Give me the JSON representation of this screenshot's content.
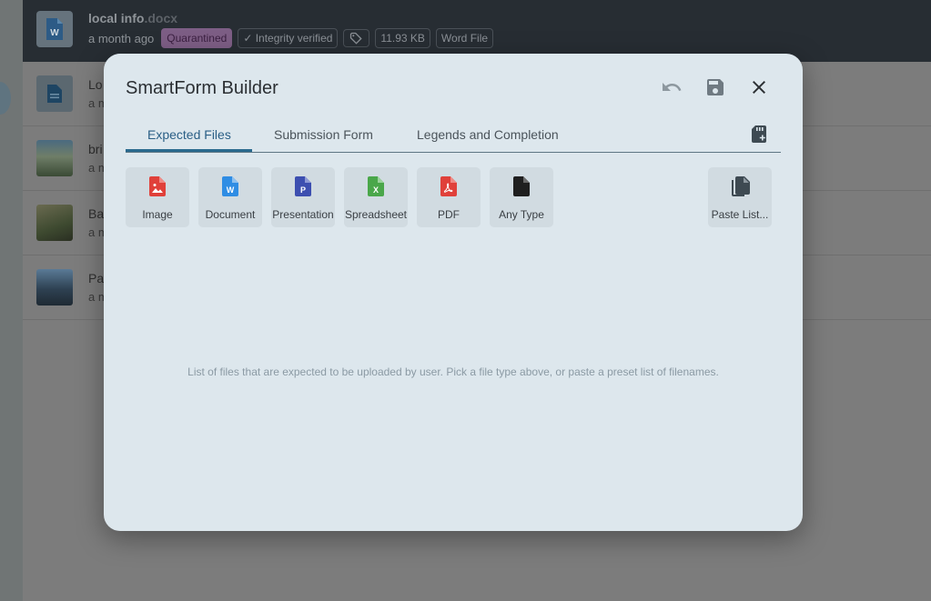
{
  "background": {
    "header": {
      "file_name": "local info",
      "file_ext": ".docx",
      "time": "a month ago",
      "chips": {
        "quarantined": "Quarantined",
        "integrity": "✓ Integrity verified",
        "size": "11.93 KB",
        "type": "Word File"
      }
    },
    "rows": [
      {
        "title": "Lo",
        "sub": "a m"
      },
      {
        "title": "bri",
        "sub": "a m"
      },
      {
        "title": "Ba",
        "sub": "a m"
      },
      {
        "title": "Pa",
        "sub": "a m"
      }
    ]
  },
  "dialog": {
    "title": "SmartForm Builder",
    "tabs": [
      {
        "label": "Expected Files"
      },
      {
        "label": "Submission Form"
      },
      {
        "label": "Legends and Completion"
      }
    ],
    "file_types": [
      {
        "label": "Image",
        "icon": "image-file-icon",
        "color": "#e0403a"
      },
      {
        "label": "Document",
        "icon": "word-file-icon",
        "color": "#2f8de4"
      },
      {
        "label": "Presentation",
        "icon": "powerpoint-file-icon",
        "color": "#3d4fb0"
      },
      {
        "label": "Spreadsheet",
        "icon": "excel-file-icon",
        "color": "#4aa74a"
      },
      {
        "label": "PDF",
        "icon": "pdf-file-icon",
        "color": "#e0403a"
      },
      {
        "label": "Any Type",
        "icon": "generic-file-icon",
        "color": "#1f1f1f"
      }
    ],
    "paste_label": "Paste List...",
    "empty_text": "List of files that are expected to be uploaded by user. Pick a file type above, or paste a preset list of filenames."
  }
}
